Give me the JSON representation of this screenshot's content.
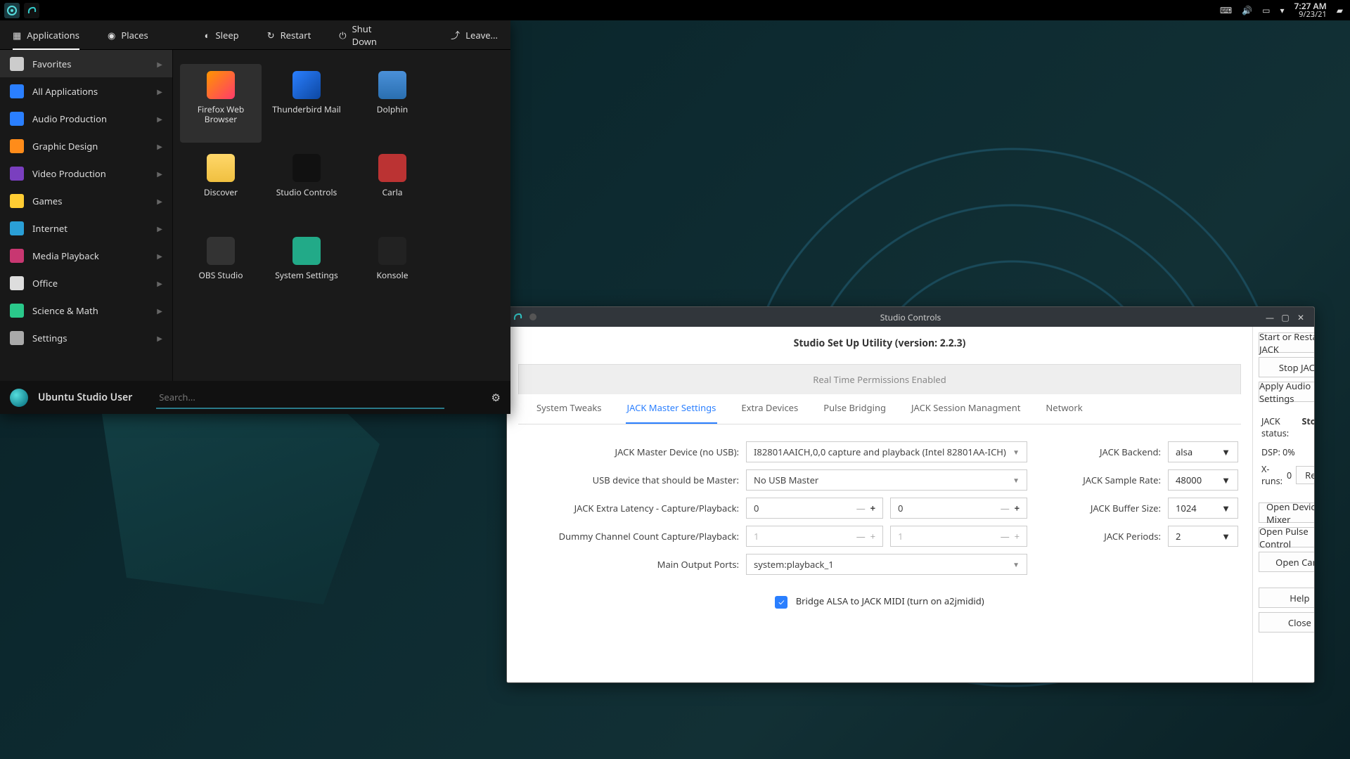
{
  "taskbar": {
    "time": "7:27 AM",
    "date": "9/23/21"
  },
  "launcher": {
    "tabs": {
      "apps": "Applications",
      "places": "Places"
    },
    "power": {
      "sleep": "Sleep",
      "restart": "Restart",
      "shutdown": "Shut Down",
      "leave": "Leave..."
    },
    "sidebar": [
      {
        "label": "Favorites",
        "color": "#ccc"
      },
      {
        "label": "All Applications",
        "color": "#2a7fff"
      },
      {
        "label": "Audio Production",
        "color": "#2a7fff"
      },
      {
        "label": "Graphic Design",
        "color": "#ff8c1a"
      },
      {
        "label": "Video Production",
        "color": "#7a3fbf"
      },
      {
        "label": "Games",
        "color": "#ffcc33"
      },
      {
        "label": "Internet",
        "color": "#2a9fd6"
      },
      {
        "label": "Media Playback",
        "color": "#c83771"
      },
      {
        "label": "Office",
        "color": "#ddd"
      },
      {
        "label": "Science & Math",
        "color": "#2ac88a"
      },
      {
        "label": "Settings",
        "color": "#aaa"
      }
    ],
    "apps": [
      {
        "label": "Firefox Web Browser",
        "bg": "linear-gradient(135deg,#ff9500,#ff3b6b)"
      },
      {
        "label": "Thunderbird Mail",
        "bg": "linear-gradient(135deg,#2a7fff,#0d47a1)"
      },
      {
        "label": "Dolphin",
        "bg": "linear-gradient(#4a90d9,#2a6fb0)"
      },
      {
        "label": "Discover",
        "bg": "linear-gradient(#ffd76a,#f0c040)"
      },
      {
        "label": "Studio Controls",
        "bg": "#111"
      },
      {
        "label": "Carla",
        "bg": "#b33"
      },
      {
        "label": "OBS Studio",
        "bg": "#333"
      },
      {
        "label": "System Settings",
        "bg": "#2a8"
      },
      {
        "label": "Konsole",
        "bg": "#222"
      }
    ],
    "user": "Ubuntu Studio User",
    "search_placeholder": "Search..."
  },
  "studio": {
    "window_title": "Studio Controls",
    "heading": "Studio Set Up Utility (version: 2.2.3)",
    "perm": "Real Time Permissions Enabled",
    "tabs": [
      "System Tweaks",
      "JACK Master Settings",
      "Extra Devices",
      "Pulse Bridging",
      "JACK Session Managment",
      "Network"
    ],
    "form": {
      "master_label": "JACK Master Device (no USB):",
      "master_value": "I82801AAICH,0,0 capture  and playback (Intel 82801AA-ICH)",
      "usb_label": "USB device that should be Master:",
      "usb_value": "No USB Master",
      "latency_label": "JACK Extra Latency - Capture/Playback:",
      "latency_cap": "0",
      "latency_play": "0",
      "dummy_label": "Dummy Channel Count Capture/Playback:",
      "dummy_cap": "1",
      "dummy_play": "1",
      "out_label": "Main Output Ports:",
      "out_value": "system:playback_1",
      "backend_label": "JACK Backend:",
      "backend_value": "alsa",
      "rate_label": "JACK Sample Rate:",
      "rate_value": "48000",
      "buffer_label": "JACK Buffer Size:",
      "buffer_value": "1024",
      "periods_label": "JACK Periods:",
      "periods_value": "2",
      "bridge": "Bridge ALSA to JACK MIDI (turn on a2jmidid)"
    },
    "side": {
      "start": "Start or Restart  JACK",
      "stop": "Stop JACK",
      "apply": "Apply Audio Settings",
      "status_label": "JACK status:",
      "status_value": "Stopped",
      "dsp": "DSP: 0%",
      "xruns_label": "X-runs:",
      "xruns_value": "0",
      "reset": "Reset",
      "mixer": "Open Device Mixer",
      "pulse": "Open Pulse Control",
      "carla": "Open Carla",
      "help": "Help",
      "close": "Close"
    }
  }
}
